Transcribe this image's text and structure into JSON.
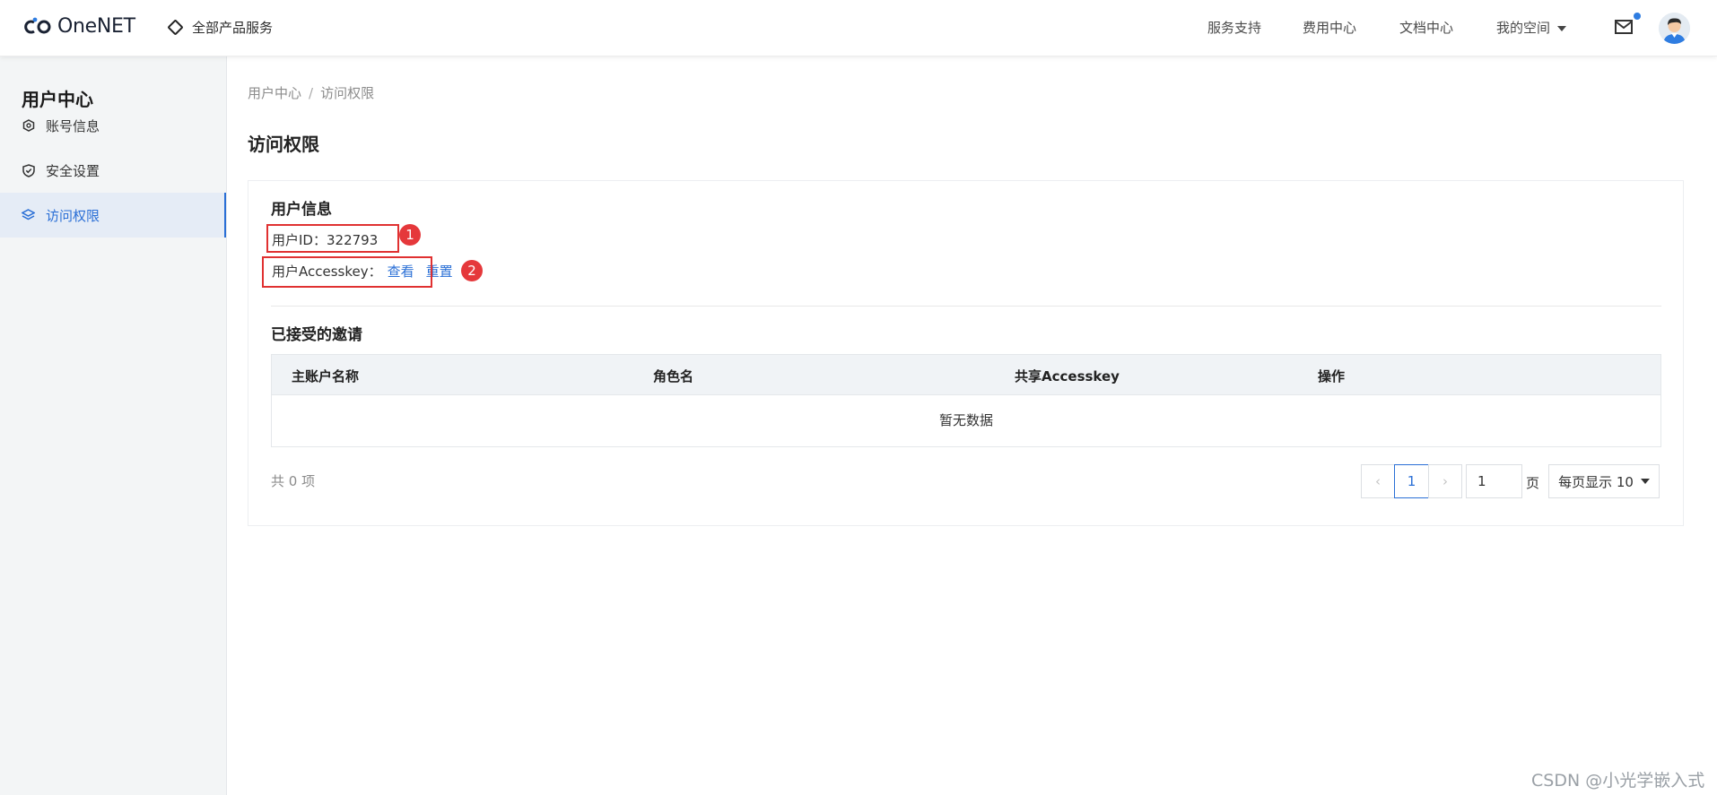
{
  "header": {
    "logo_text": "OneNET",
    "all_products": "全部产品服务",
    "nav": [
      "服务支持",
      "费用中心",
      "文档中心",
      "我的空间"
    ]
  },
  "sidebar": {
    "title": "用户中心",
    "items": [
      {
        "label": "账号信息",
        "icon": "hexagon-icon"
      },
      {
        "label": "安全设置",
        "icon": "shield-icon"
      },
      {
        "label": "访问权限",
        "icon": "layers-icon",
        "active": true
      }
    ]
  },
  "breadcrumb": {
    "root": "用户中心",
    "separator": "/",
    "current": "访问权限"
  },
  "page_title": "访问权限",
  "user_info": {
    "title": "用户信息",
    "id_label": "用户ID：",
    "id_value": "322793",
    "accesskey_label": "用户Accesskey：",
    "view": "查看",
    "reset": "重置",
    "badge1": "1",
    "badge2": "2"
  },
  "invitations": {
    "title": "已接受的邀请",
    "columns": [
      "主账户名称",
      "角色名",
      "共享Accesskey",
      "操作"
    ],
    "empty": "暂无数据"
  },
  "pagination": {
    "total": "共 0 项",
    "prev": "‹",
    "current": "1",
    "next": "›",
    "jump_value": "1",
    "page_unit": "页",
    "page_size": "每页显示 10"
  },
  "watermark": "CSDN @小光学嵌入式",
  "colors": {
    "accent": "#2a6fd6",
    "annotation": "#e03131"
  }
}
